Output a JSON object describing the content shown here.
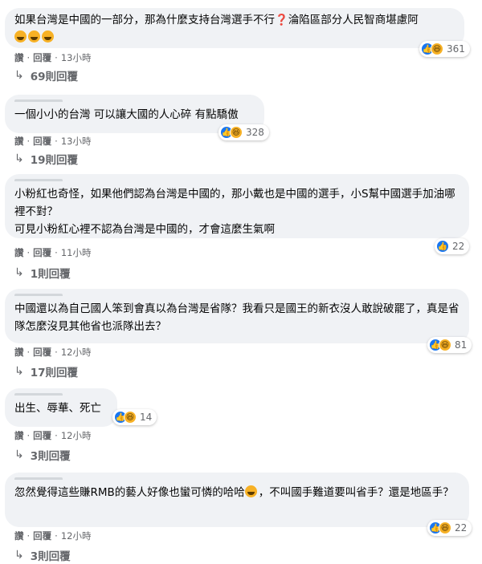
{
  "meta_labels": {
    "like": "讚",
    "sep": "·",
    "reply": "回覆"
  },
  "comments": [
    {
      "text_pre": "如果台灣是中國的一部分，那為什麼支持台灣選手不行",
      "text_q": "❓",
      "text_post": "淪陷區部分人民智商堪慮阿",
      "time": "13小時",
      "reactions": "361",
      "replies": "69則回覆"
    },
    {
      "text": "一個小小的台灣 可以讓大國的人心碎 有點驕傲",
      "time": "13小時",
      "reactions": "328",
      "replies": "19則回覆"
    },
    {
      "text": "小粉紅也奇怪，如果他們認為台灣是中國的，那小戴也是中國的選手，小S幫中國選手加油哪裡不對？\n可見小粉紅心裡不認為台灣是中國的，才會這麼生氣啊",
      "time": "11小時",
      "reactions": "22",
      "replies": "1則回覆"
    },
    {
      "text": "中國還以為自己國人笨到會真以為台灣是省隊？我看只是國王的新衣沒人敢說破罷了，真是省隊怎麼沒見其他省也派隊出去？",
      "time": "12小時",
      "reactions": "81",
      "replies": "17則回覆"
    },
    {
      "text": "出生、辱華、死亡",
      "time": "12小時",
      "reactions": "14",
      "replies": "3則回覆"
    },
    {
      "text_pre": "忽然覺得這些賺RMB的藝人好像也蠻可憐的哈哈",
      "text_post": "，不叫國手難道要叫省手？還是地區手？",
      "time": "12小時",
      "reactions": "22",
      "replies": "3則回覆"
    }
  ]
}
